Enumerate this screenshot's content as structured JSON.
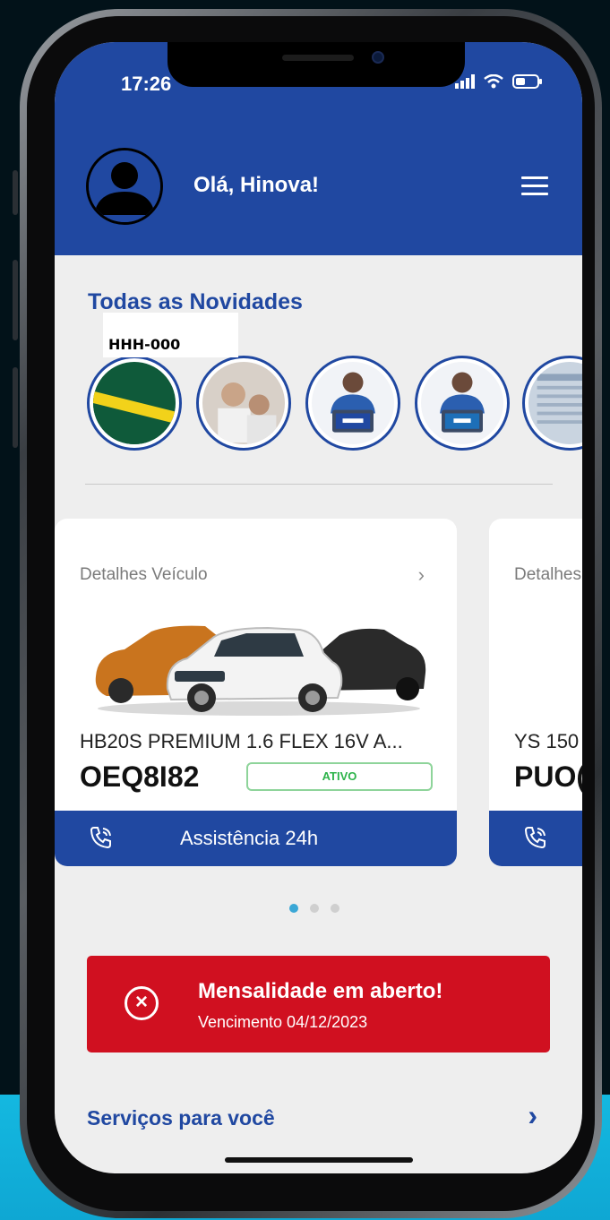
{
  "status_bar": {
    "time": "17:26"
  },
  "header": {
    "greeting": "Olá, Hinova!"
  },
  "news": {
    "title": "Todas as Novidades"
  },
  "overlay_tag": "HHH-000",
  "vehicle_card": {
    "label": "Detalhes Veículo",
    "model": "HB20S PREMIUM 1.6 FLEX 16V A...",
    "plate": "OEQ8I82",
    "status": "ATIVO",
    "assist_label": "Assistência 24h"
  },
  "peek_card": {
    "label": "Detalhes",
    "model": "YS 150",
    "plate": "PUO("
  },
  "pagination": {
    "total": 3,
    "active": 1
  },
  "alert": {
    "title": "Mensalidade em aberto!",
    "subtitle": "Vencimento 04/12/2023"
  },
  "services": {
    "title": "Serviços para você"
  },
  "colors": {
    "primary": "#2048a1",
    "alert": "#d01020",
    "status_green": "#2db34a",
    "dot_active": "#3aa7d6"
  }
}
